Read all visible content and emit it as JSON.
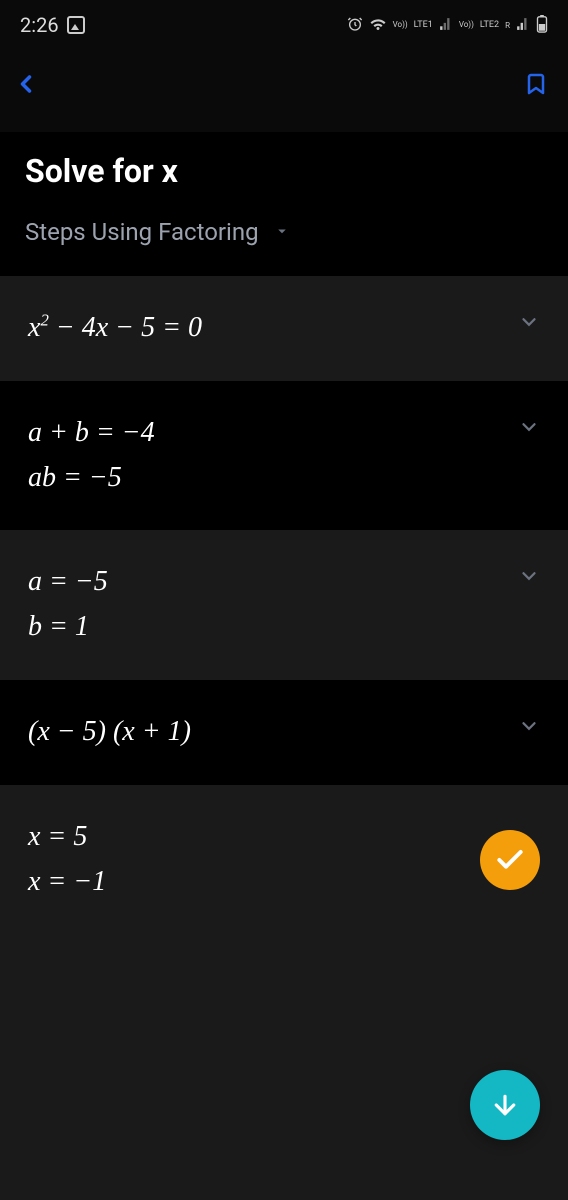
{
  "status": {
    "time": "2:26",
    "lte1": "LTE1",
    "lte2": "LTE2",
    "vo1": "Vo))",
    "vo2": "Vo))",
    "r": "R"
  },
  "title": "Solve for x",
  "method": "Steps Using Factoring",
  "steps": {
    "s1": {
      "line1_html": "<i>x</i><sup>2</sup> − 4<i>x</i> − 5 = 0"
    },
    "s2": {
      "line1": "a + b = −4",
      "line2": "ab = −5"
    },
    "s3": {
      "line1": "a = −5",
      "line2": "b = 1"
    },
    "s4": {
      "line1": "(x − 5) (x + 1)"
    },
    "s5": {
      "line1": "x = 5",
      "line2": "x = −1"
    }
  }
}
